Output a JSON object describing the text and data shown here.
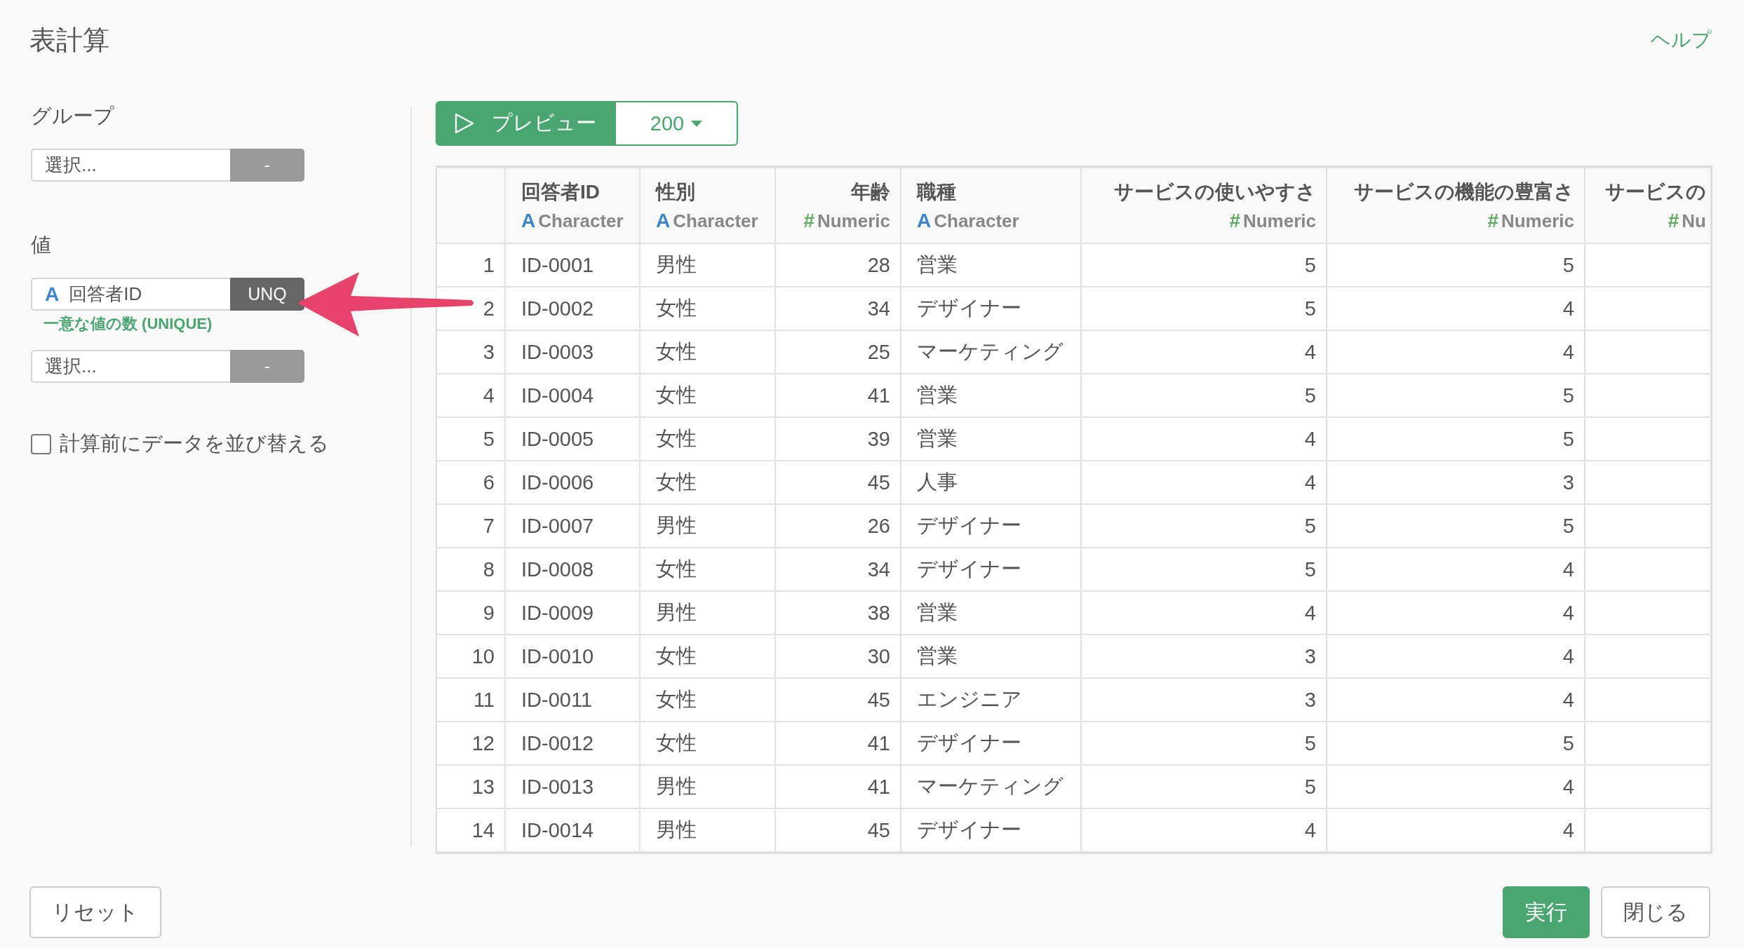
{
  "title": "表計算",
  "help_link": "ヘルプ",
  "group": {
    "label": "グループ",
    "fields": [
      {
        "placeholder": "選択...",
        "button": "-",
        "active": false
      }
    ]
  },
  "value": {
    "label": "値",
    "fields": [
      {
        "type_icon": "A",
        "value": "回答者ID",
        "button": "UNQ",
        "caption": "一意な値の数 (UNIQUE)",
        "active": true
      },
      {
        "placeholder": "選択...",
        "button": "-",
        "active": false
      }
    ]
  },
  "sort_option": {
    "label": "計算前にデータを並び替える",
    "checked": false
  },
  "preview": {
    "label": "プレビュー",
    "rows": "200"
  },
  "table": {
    "columns": [
      {
        "name": "回答者ID",
        "kind": "character",
        "type_icon": "A",
        "type": "Character"
      },
      {
        "name": "性別",
        "kind": "character",
        "type_icon": "A",
        "type": "Character"
      },
      {
        "name": "年齢",
        "kind": "numeric",
        "type_icon": "#",
        "type": "Numeric"
      },
      {
        "name": "職種",
        "kind": "character",
        "type_icon": "A",
        "type": "Character"
      },
      {
        "name": "サービスの使いやすさ",
        "kind": "numeric",
        "type_icon": "#",
        "type": "Numeric"
      },
      {
        "name": "サービスの機能の豊富さ",
        "kind": "numeric",
        "type_icon": "#",
        "type": "Numeric"
      },
      {
        "name": "サービスの",
        "kind": "numeric",
        "type_icon": "#",
        "type": "Nu"
      }
    ],
    "rows": [
      {
        "index": "1",
        "cells": [
          "ID-0001",
          "男性",
          "28",
          "営業",
          "5",
          "5"
        ]
      },
      {
        "index": "2",
        "cells": [
          "ID-0002",
          "女性",
          "34",
          "デザイナー",
          "5",
          "4"
        ]
      },
      {
        "index": "3",
        "cells": [
          "ID-0003",
          "女性",
          "25",
          "マーケティング",
          "4",
          "4"
        ]
      },
      {
        "index": "4",
        "cells": [
          "ID-0004",
          "女性",
          "41",
          "営業",
          "5",
          "5"
        ]
      },
      {
        "index": "5",
        "cells": [
          "ID-0005",
          "女性",
          "39",
          "営業",
          "4",
          "5"
        ]
      },
      {
        "index": "6",
        "cells": [
          "ID-0006",
          "女性",
          "45",
          "人事",
          "4",
          "3"
        ]
      },
      {
        "index": "7",
        "cells": [
          "ID-0007",
          "男性",
          "26",
          "デザイナー",
          "5",
          "5"
        ]
      },
      {
        "index": "8",
        "cells": [
          "ID-0008",
          "女性",
          "34",
          "デザイナー",
          "5",
          "4"
        ]
      },
      {
        "index": "9",
        "cells": [
          "ID-0009",
          "男性",
          "38",
          "営業",
          "4",
          "4"
        ]
      },
      {
        "index": "10",
        "cells": [
          "ID-0010",
          "女性",
          "30",
          "営業",
          "3",
          "4"
        ]
      },
      {
        "index": "11",
        "cells": [
          "ID-0011",
          "女性",
          "45",
          "エンジニア",
          "3",
          "4"
        ]
      },
      {
        "index": "12",
        "cells": [
          "ID-0012",
          "女性",
          "41",
          "デザイナー",
          "5",
          "5"
        ]
      },
      {
        "index": "13",
        "cells": [
          "ID-0013",
          "男性",
          "41",
          "マーケティング",
          "5",
          "4"
        ]
      },
      {
        "index": "14",
        "cells": [
          "ID-0014",
          "男性",
          "45",
          "デザイナー",
          "4",
          "4"
        ]
      }
    ]
  },
  "footer": {
    "left_buttons": [
      {
        "label": "リセット",
        "kind": "default"
      }
    ],
    "right_buttons": [
      {
        "label": "実行",
        "kind": "primary"
      },
      {
        "label": "閉じる",
        "kind": "default"
      }
    ]
  }
}
